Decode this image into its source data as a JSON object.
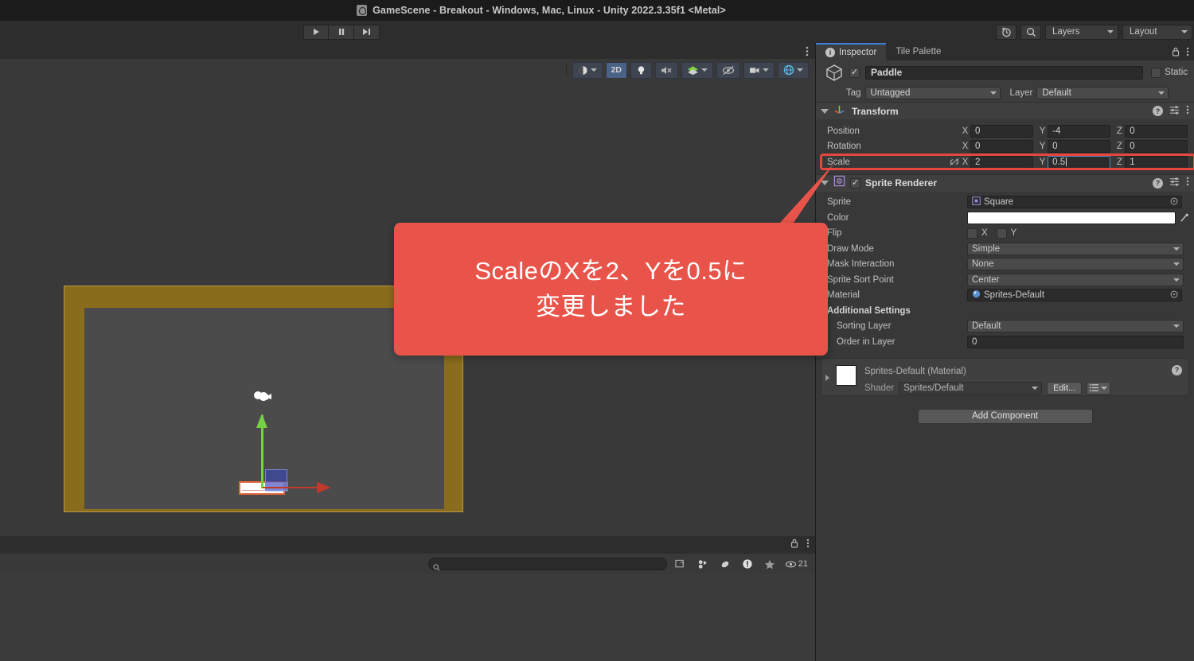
{
  "window": {
    "title": "GameScene - Breakout - Windows, Mac, Linux - Unity 2022.3.35f1 <Metal>",
    "icon": "unity-app-icon"
  },
  "toolbar": {
    "play_label": "▶",
    "pause_label": "❚❚",
    "step_label": "▶❙",
    "history_icon": "undo-history-icon",
    "search_icon": "search-icon",
    "layers_label": "Layers",
    "layout_label": "Layout"
  },
  "scene_toolbar": {
    "shading_label": "",
    "mode_2d_label": "2D",
    "lighting_icon": "lightbulb-icon",
    "audio_icon": "audio-mute-icon",
    "fx_icon": "effects-icon",
    "hidden_icon": "hidden-objects-icon",
    "camera_icon": "scene-camera-icon",
    "gizmos_icon": "gizmos-icon"
  },
  "console": {
    "search_placeholder": "",
    "search_value": "",
    "collapse_icon": "collapse-icon",
    "clearonplay_icon": "clear-on-play-icon",
    "error_pause_icon": "error-pause-icon",
    "log_icon": "log-icon",
    "favorite_icon": "star-icon",
    "eye_icon": "eye-icon",
    "eye_count": "21",
    "lock_icon": "lock-icon",
    "menu_icon": "kebab-menu-icon"
  },
  "inspector": {
    "tabs": [
      {
        "label": "Inspector",
        "active": true,
        "icon": "info-icon"
      },
      {
        "label": "Tile Palette",
        "active": false,
        "icon": ""
      }
    ],
    "lock_icon": "lock-icon",
    "menu_icon": "kebab-menu-icon",
    "object": {
      "enabled": true,
      "name": "Paddle",
      "static_label": "Static",
      "static_checked": false,
      "tag_label": "Tag",
      "tag_value": "Untagged",
      "layer_label": "Layer",
      "layer_value": "Default"
    },
    "transform": {
      "title": "Transform",
      "icon": "transform-axes-icon",
      "rows": [
        {
          "label": "Position",
          "x": "0",
          "y": "-4",
          "z": "0",
          "linked": false,
          "highlighted": false,
          "focus": ""
        },
        {
          "label": "Rotation",
          "x": "0",
          "y": "0",
          "z": "0",
          "linked": false,
          "highlighted": false,
          "focus": ""
        },
        {
          "label": "Scale",
          "x": "2",
          "y": "0.5",
          "z": "1",
          "linked": true,
          "highlighted": true,
          "focus": "y"
        }
      ],
      "link_icon": "constrain-proportions-broken-icon",
      "help_icon": "help-icon",
      "preset_icon": "preset-icon",
      "menu_icon": "kebab-menu-icon"
    },
    "sprite_renderer": {
      "title": "Sprite Renderer",
      "enabled": true,
      "icon": "sprite-renderer-icon",
      "sprite_label": "Sprite",
      "sprite_value": "Square",
      "color_label": "Color",
      "color_value": "#FFFFFF",
      "flip_label": "Flip",
      "flip_x_label": "X",
      "flip_y_label": "Y",
      "flip_x": false,
      "flip_y": false,
      "draw_mode_label": "Draw Mode",
      "draw_mode_value": "Simple",
      "mask_interaction_label": "Mask Interaction",
      "mask_interaction_value": "None",
      "sort_point_label": "Sprite Sort Point",
      "sort_point_value": "Center",
      "material_label": "Material",
      "material_value": "Sprites-Default",
      "additional_settings_label": "Additional Settings",
      "sorting_layer_label": "Sorting Layer",
      "sorting_layer_value": "Default",
      "order_in_layer_label": "Order in Layer",
      "order_in_layer_value": "0"
    },
    "material_block": {
      "title": "Sprites-Default (Material)",
      "shader_label": "Shader",
      "shader_value": "Sprites/Default",
      "edit_label": "Edit...",
      "help_icon": "help-icon",
      "menu_icon": "preset-list-icon"
    },
    "add_component_label": "Add Component"
  },
  "callout": {
    "text": "ScaleのXを2、Yを0.5に\n変更しました",
    "background": "#E8544A",
    "text_color": "#FFFFFF"
  },
  "highlight": {
    "color": "#E8463C",
    "target": "scale-row"
  },
  "scene": {
    "wall_color": "#8A6D1C",
    "interior_color": "#4B4B4B",
    "paddle_color": "#FFFFFF",
    "paddle_outline": "#E8663C",
    "gizmo_y_color": "#74D045",
    "gizmo_x_color": "#C0392B",
    "camera_icon": "scene-camera-gizmo-icon"
  }
}
